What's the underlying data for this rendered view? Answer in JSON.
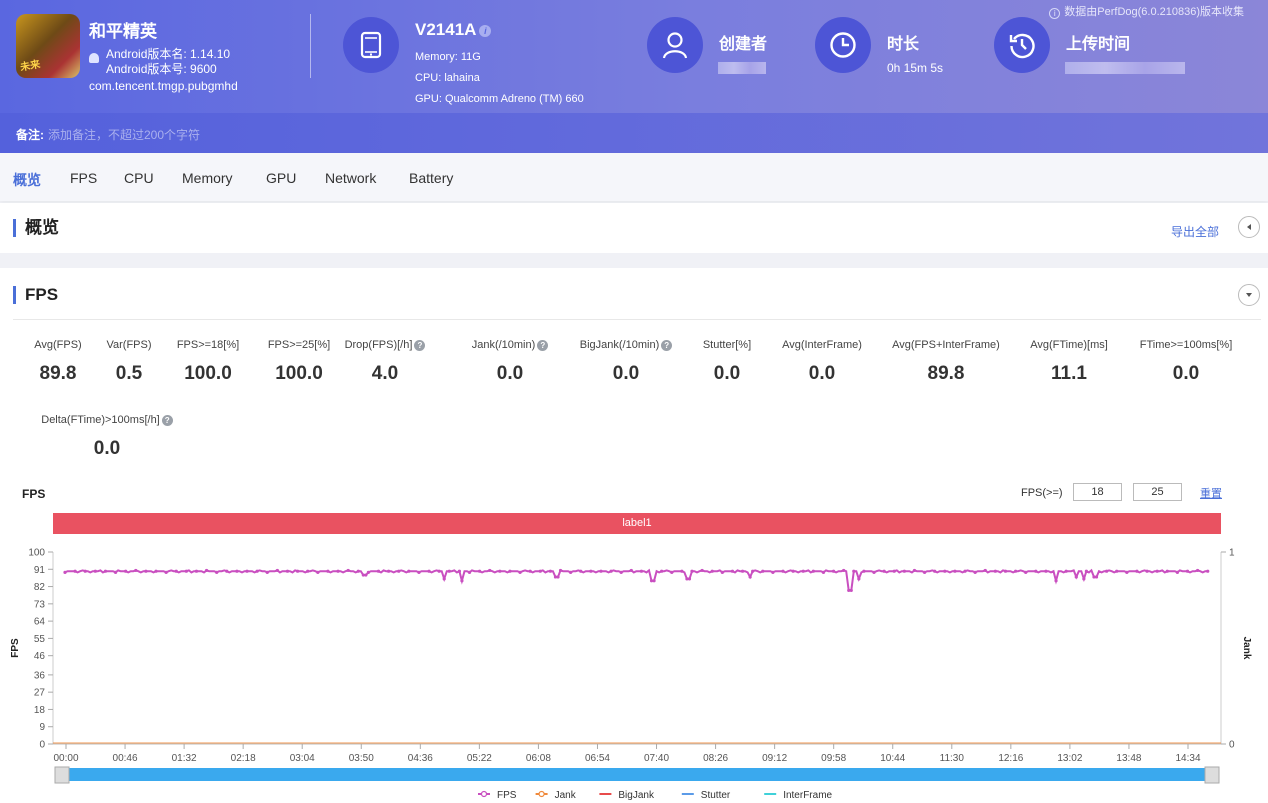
{
  "app": {
    "name": "和平精英",
    "version_name": "Android版本名: 1.14.10",
    "version_code": "Android版本号: 9600",
    "package": "com.tencent.tmgp.pubgmhd",
    "icon_badge": "未来"
  },
  "device": {
    "model": "V2141A",
    "memory": "Memory: 11G",
    "cpu": "CPU: lahaina",
    "gpu": "GPU: Qualcomm Adreno (TM) 660"
  },
  "meta": {
    "creator_label": "创建者",
    "duration_label": "时长",
    "duration_value": "0h 15m 5s",
    "upload_label": "上传时间",
    "source_note": "数据由PerfDog(6.0.210836)版本收集"
  },
  "note": {
    "label": "备注:",
    "placeholder": "添加备注，不超过200个字符"
  },
  "tabs": [
    {
      "label": "概览",
      "active": true
    },
    {
      "label": "FPS"
    },
    {
      "label": "CPU"
    },
    {
      "label": "Memory"
    },
    {
      "label": "GPU"
    },
    {
      "label": "Network"
    },
    {
      "label": "Battery"
    }
  ],
  "overview": {
    "title": "概览",
    "export_label": "导出全部"
  },
  "fps_section": {
    "title": "FPS",
    "stats": [
      {
        "label": "Avg(FPS)",
        "value": "89.8"
      },
      {
        "label": "Var(FPS)",
        "value": "0.5"
      },
      {
        "label": "FPS>=18[%]",
        "value": "100.0"
      },
      {
        "label": "FPS>=25[%]",
        "value": "100.0"
      },
      {
        "label": "Drop(FPS)[/h]",
        "value": "4.0",
        "help": true
      },
      {
        "label": "Jank(/10min)",
        "value": "0.0",
        "help": true
      },
      {
        "label": "BigJank(/10min)",
        "value": "0.0",
        "help": true
      },
      {
        "label": "Stutter[%]",
        "value": "0.0"
      },
      {
        "label": "Avg(InterFrame)",
        "value": "0.0"
      },
      {
        "label": "Avg(FPS+InterFrame)",
        "value": "89.8"
      },
      {
        "label": "Avg(FTime)[ms]",
        "value": "11.1"
      },
      {
        "label": "FTime>=100ms[%]",
        "value": "0.0"
      },
      {
        "label": "Delta(FTime)>100ms[/h]",
        "value": "0.0",
        "help": true
      }
    ],
    "chart_title": "FPS",
    "threshold_label": "FPS(>=)",
    "threshold_1": "18",
    "threshold_2": "25",
    "reset_label": "重置",
    "label_band": "label1",
    "help_glyph": "?"
  },
  "chart_data": {
    "type": "line",
    "title": "FPS",
    "xlabel": "",
    "ylabel": "FPS",
    "y2label": "Jank",
    "ylim": [
      0,
      100
    ],
    "y2lim": [
      0,
      1
    ],
    "yticks": [
      0,
      9,
      18,
      27,
      36,
      46,
      55,
      64,
      73,
      82,
      91,
      100
    ],
    "y2ticks": [
      0,
      1
    ],
    "xlim_seconds": [
      0,
      905
    ],
    "xticks": [
      "00:00",
      "00:46",
      "01:32",
      "02:18",
      "03:04",
      "03:50",
      "04:36",
      "05:22",
      "06:08",
      "06:54",
      "07:40",
      "08:26",
      "09:12",
      "09:58",
      "10:44",
      "11:30",
      "12:16",
      "13:02",
      "13:48",
      "14:34"
    ],
    "baseline_fps": 90,
    "fps_dips": [
      {
        "t": 237,
        "fps": 88
      },
      {
        "t": 300,
        "fps": 86
      },
      {
        "t": 314,
        "fps": 85
      },
      {
        "t": 389,
        "fps": 87
      },
      {
        "t": 465,
        "fps": 85
      },
      {
        "t": 493,
        "fps": 86
      },
      {
        "t": 542,
        "fps": 87
      },
      {
        "t": 621,
        "fps": 80
      },
      {
        "t": 628,
        "fps": 86
      },
      {
        "t": 784,
        "fps": 85
      },
      {
        "t": 800,
        "fps": 87
      },
      {
        "t": 806,
        "fps": 86
      },
      {
        "t": 815,
        "fps": 87
      }
    ],
    "series": [
      {
        "name": "FPS",
        "color": "#c94fc0",
        "marker": "circle"
      },
      {
        "name": "Jank",
        "color": "#f08a3c",
        "marker": "circle",
        "value": 0
      },
      {
        "name": "BigJank",
        "color": "#e84b4b",
        "value": 0
      },
      {
        "name": "Stutter",
        "color": "#5b9be8",
        "value": 0
      },
      {
        "name": "InterFrame",
        "color": "#3fd1d9",
        "value": 0
      }
    ],
    "legend_position": "bottom-center",
    "grid": false
  }
}
